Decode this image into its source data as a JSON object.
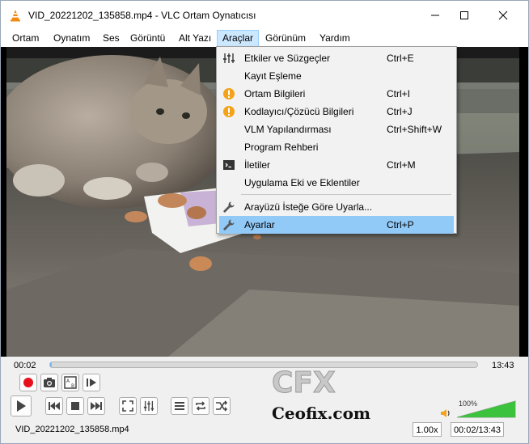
{
  "window": {
    "title": "VID_20221202_135858.mp4 - VLC Ortam Oynatıcısı"
  },
  "menubar": {
    "items": [
      {
        "label": "Ortam"
      },
      {
        "label": "Oynatım"
      },
      {
        "label": "Ses"
      },
      {
        "label": "Görüntü"
      },
      {
        "label": "Alt Yazı"
      },
      {
        "label": "Araçlar"
      },
      {
        "label": "Görünüm"
      },
      {
        "label": "Yardım"
      }
    ]
  },
  "tools_menu": {
    "items": [
      {
        "label": "Etkiler ve Süzgeçler",
        "shortcut": "Ctrl+E",
        "icon": "equalizer-icon"
      },
      {
        "label": "Kayıt Eşleme",
        "shortcut": "",
        "icon": ""
      },
      {
        "label": "Ortam Bilgileri",
        "shortcut": "Ctrl+I",
        "icon": "info-icon"
      },
      {
        "label": "Kodlayıcı/Çözücü Bilgileri",
        "shortcut": "Ctrl+J",
        "icon": "info-icon"
      },
      {
        "label": "VLM Yapılandırması",
        "shortcut": "Ctrl+Shift+W",
        "icon": ""
      },
      {
        "label": "Program Rehberi",
        "shortcut": "",
        "icon": ""
      },
      {
        "label": "İletiler",
        "shortcut": "Ctrl+M",
        "icon": "terminal-icon"
      },
      {
        "label": "Uygulama Eki ve Eklentiler",
        "shortcut": "",
        "icon": ""
      },
      {
        "label": "Arayüzü İsteğe Göre Uyarla...",
        "shortcut": "",
        "icon": "wrench-icon"
      },
      {
        "label": "Ayarlar",
        "shortcut": "Ctrl+P",
        "icon": "wrench-icon"
      }
    ]
  },
  "player": {
    "elapsed": "00:02",
    "total": "13:43",
    "progress": 0.003,
    "volume_label": "100%",
    "volume": 1.0
  },
  "status": {
    "filename": "VID_20221202_135858.mp4",
    "speed": "1.00x",
    "time": "00:02/13:43"
  },
  "watermark": {
    "logo": "CFX",
    "site": "Ceofix.com"
  },
  "colors": {
    "highlight": "#91c9f7",
    "record_red": "#e8101a",
    "volume_green": "#3cc23c",
    "info_orange": "#f4a21a"
  }
}
